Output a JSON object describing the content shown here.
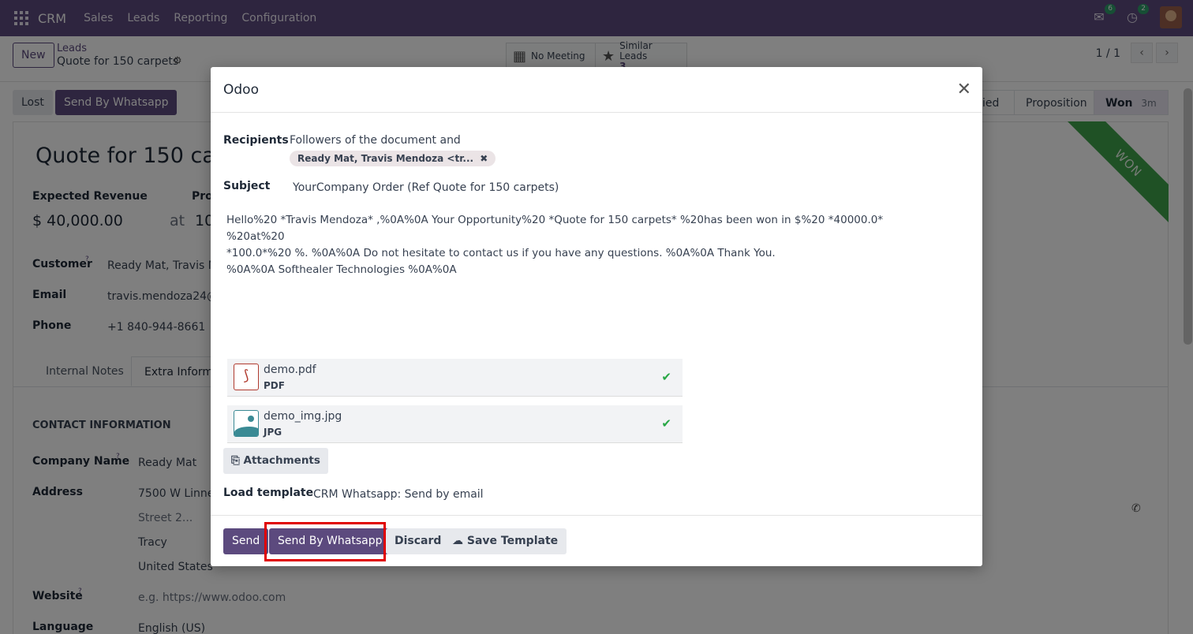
{
  "nav": {
    "brand": "CRM",
    "menu": [
      "Sales",
      "Leads",
      "Reporting",
      "Configuration"
    ],
    "messages_count": "6",
    "activities_count": "2"
  },
  "control_panel": {
    "new_label": "New",
    "breadcrumb_parent": "Leads",
    "breadcrumb_current": "Quote for 150 carpets",
    "meeting_label": "No Meeting",
    "similar_label": "Similar Leads",
    "similar_count": "3",
    "pager": "1 / 1"
  },
  "statusbar": {
    "lost_label": "Lost",
    "whatsapp_label": "Send By Whatsapp",
    "stage_partial": "ied",
    "stage_proposition": "Proposition",
    "stage_won": "Won",
    "won_time": "3m"
  },
  "record": {
    "title": "Quote for 150 car",
    "expected_revenue_label": "Expected Revenue",
    "probability_label": "Pro",
    "revenue": "$ 40,000.00",
    "at": "at",
    "probability": "10",
    "customer_label": "Customer",
    "customer": "Ready Mat, Travis Me",
    "email_label": "Email",
    "email": "travis.mendoza24@e",
    "phone_label": "Phone",
    "phone": "+1 840-944-8661",
    "ribbon": "WON",
    "tab_notes": "Internal Notes",
    "tab_extra": "Extra Informa",
    "section_contact": "CONTACT INFORMATION",
    "company_label": "Company Name",
    "company": "Ready Mat",
    "address_label": "Address",
    "street": "7500 W Linne R",
    "street2": "Street 2...",
    "city": "Tracy",
    "country": "United States",
    "website_label": "Website",
    "website_placeholder": "e.g. https://www.odoo.com",
    "language_label": "Language",
    "language": "English (US)"
  },
  "modal": {
    "title": "Odoo",
    "recipients_label": "Recipients",
    "recipients_text": "Followers of the document and",
    "recipient_tag": "Ready Mat, Travis Mendoza <tr...",
    "subject_label": "Subject",
    "subject": "YourCompany Order (Ref Quote for 150 carpets)",
    "body_line1": "Hello%20 *Travis Mendoza* ,%0A%0A Your Opportunity%20 *Quote for 150 carpets* %20has been won in $%20 *40000.0* %20at%20",
    "body_line2": "*100.0*%20 %. %0A%0A Do not hesitate to contact us if you have any questions. %0A%0A Thank You.",
    "body_line3": "%0A%0A Softhealer Technologies %0A%0A",
    "attachments": [
      {
        "name": "demo.pdf",
        "type": "PDF"
      },
      {
        "name": "demo_img.jpg",
        "type": "JPG"
      }
    ],
    "attachments_button": "Attachments",
    "load_template_label": "Load template",
    "load_template_value": "CRM Whatsapp: Send by email",
    "send_label": "Send",
    "send_whatsapp_label": "Send By Whatsapp",
    "discard_label": "Discard",
    "save_template_label": "Save Template"
  },
  "colors": {
    "primary": "#5c4a7e",
    "won_ribbon": "#3fa24b",
    "highlight": "#e00000"
  }
}
